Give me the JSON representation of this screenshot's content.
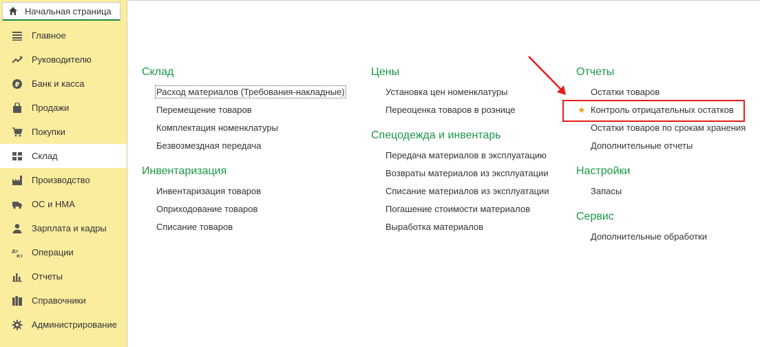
{
  "tab": {
    "label": "Начальная страница",
    "icon": "home-icon"
  },
  "sidebar": {
    "items": [
      {
        "label": "Главное",
        "icon": "menu-lines-icon"
      },
      {
        "label": "Руководителю",
        "icon": "trend-up-icon"
      },
      {
        "label": "Банк и касса",
        "icon": "ruble-coin-icon"
      },
      {
        "label": "Продажи",
        "icon": "shopping-bag-icon"
      },
      {
        "label": "Покупки",
        "icon": "cart-icon"
      },
      {
        "label": "Склад",
        "icon": "warehouse-grid-icon"
      },
      {
        "label": "Производство",
        "icon": "factory-icon"
      },
      {
        "label": "ОС и НМА",
        "icon": "truck-icon"
      },
      {
        "label": "Зарплата и кадры",
        "icon": "person-icon"
      },
      {
        "label": "Операции",
        "icon": "dt-kt-icon"
      },
      {
        "label": "Отчеты",
        "icon": "bar-chart-icon"
      },
      {
        "label": "Справочники",
        "icon": "books-icon"
      },
      {
        "label": "Администрирование",
        "icon": "gear-icon"
      }
    ],
    "active_index": 5
  },
  "columns": {
    "col1": {
      "sections": [
        {
          "title": "Склад",
          "links": [
            "Расход материалов (Требования-накладные)",
            "Перемещение товаров",
            "Комплектация номенклатуры",
            "Безвозмездная передача"
          ]
        },
        {
          "title": "Инвентаризация",
          "links": [
            "Инвентаризация товаров",
            "Оприходование товаров",
            "Списание товаров"
          ]
        }
      ]
    },
    "col2": {
      "sections": [
        {
          "title": "Цены",
          "links": [
            "Установка цен номенклатуры",
            "Переоценка товаров в рознице"
          ]
        },
        {
          "title": "Спецодежда и инвентарь",
          "links": [
            "Передача материалов в эксплуатацию",
            "Возвраты материалов из эксплуатации",
            "Списание материалов из эксплуатации",
            "Погашение стоимости материалов",
            "Выработка материалов"
          ]
        }
      ]
    },
    "col3": {
      "sections": [
        {
          "title": "Отчеты",
          "links": [
            "Остатки товаров",
            "Контроль отрицательных остатков",
            "Остатки товаров по срокам хранения",
            "Дополнительные отчеты"
          ]
        },
        {
          "title": "Настройки",
          "links": [
            "Запасы"
          ]
        },
        {
          "title": "Сервис",
          "links": [
            "Дополнительные обработки"
          ]
        }
      ]
    }
  },
  "colors": {
    "sidebar_bg": "#fbed9e",
    "section_title": "#1a9a47",
    "highlight": "#e41c1c",
    "star": "#f0a030"
  }
}
